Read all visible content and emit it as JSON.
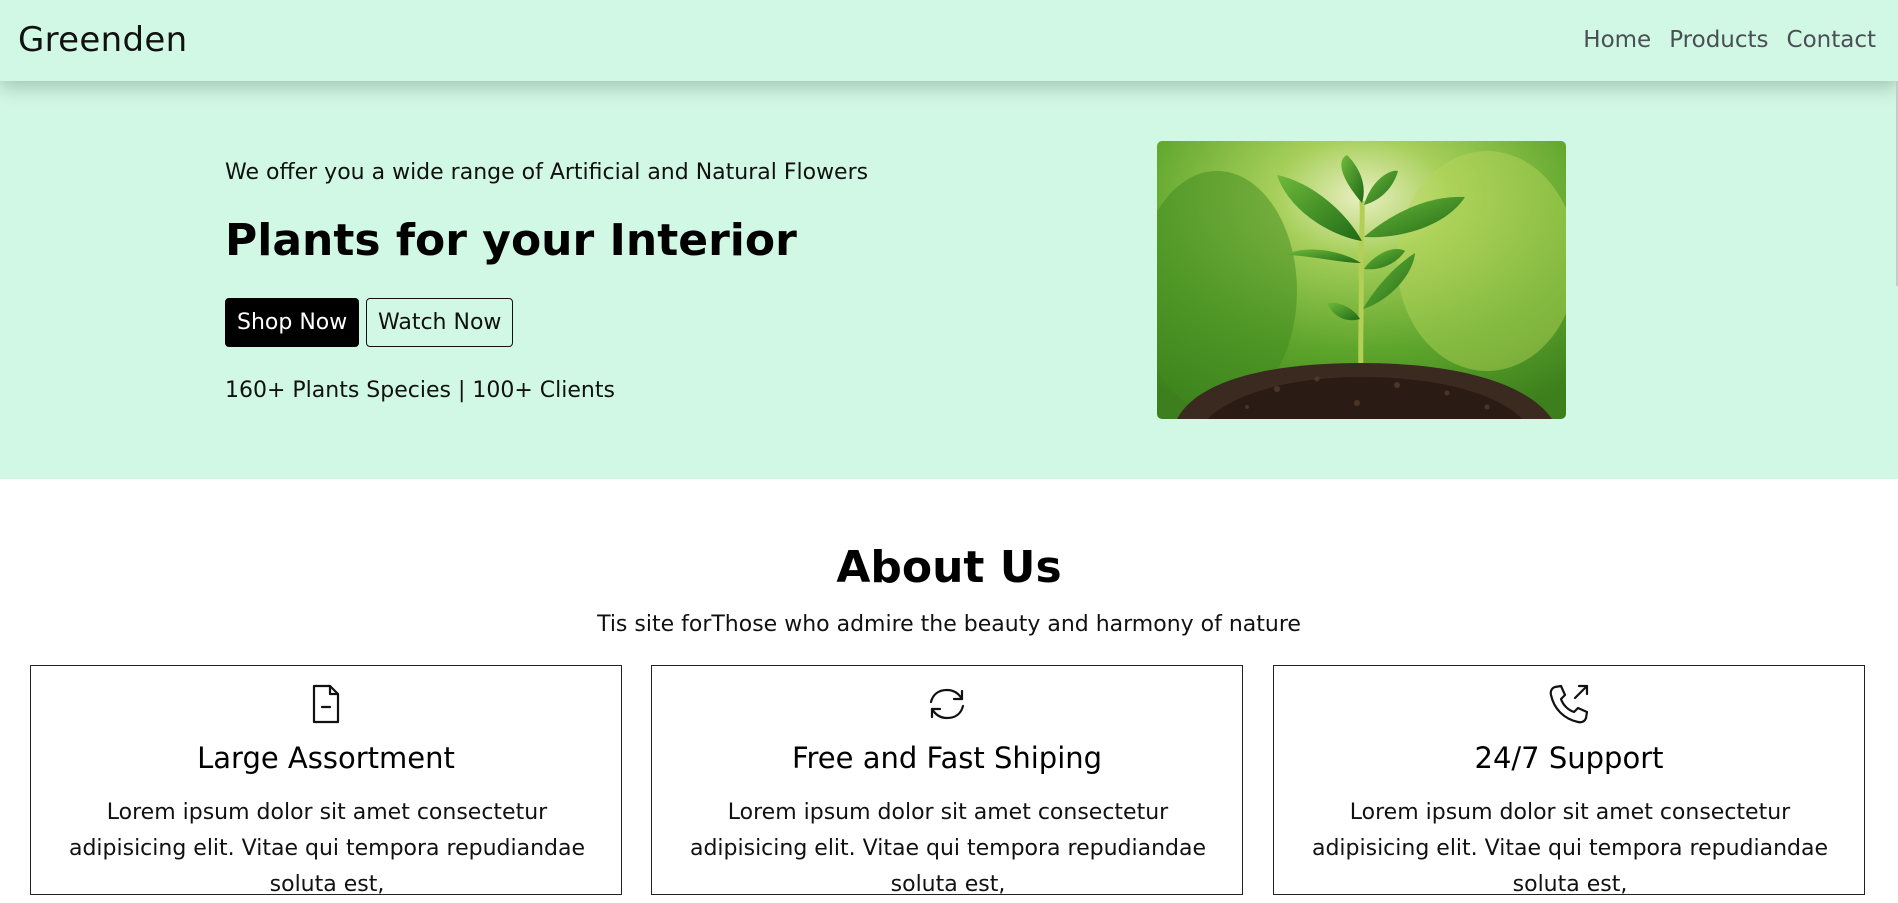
{
  "nav": {
    "brand": "Greenden",
    "links": [
      "Home",
      "Products",
      "Contact"
    ]
  },
  "hero": {
    "eyebrow": "We offer you a wide range of Artificial and Natural Flowers",
    "title": "Plants for your Interior",
    "primary_button": "Shop Now",
    "secondary_button": "Watch Now",
    "stats": "160+ Plants Species | 100+ Clients"
  },
  "about": {
    "title": "About Us",
    "subtitle": "Tis site forThose who admire the beauty and harmony of nature",
    "cards": [
      {
        "icon": "document-icon",
        "title": "Large Assortment",
        "text": "Lorem ipsum dolor sit amet consectetur adipisicing elit. Vitae qui tempora repudiandae soluta est,"
      },
      {
        "icon": "refresh-icon",
        "title": "Free and Fast Shiping",
        "text": "Lorem ipsum dolor sit amet consectetur adipisicing elit. Vitae qui tempora repudiandae soluta est,"
      },
      {
        "icon": "phone-outgoing-icon",
        "title": "24/7 Support",
        "text": "Lorem ipsum dolor sit amet consectetur adipisicing elit. Vitae qui tempora repudiandae soluta est,"
      }
    ]
  },
  "colors": {
    "mint": "#d1f8e4",
    "dark": "#000000",
    "nav_link": "#4a4f55"
  }
}
